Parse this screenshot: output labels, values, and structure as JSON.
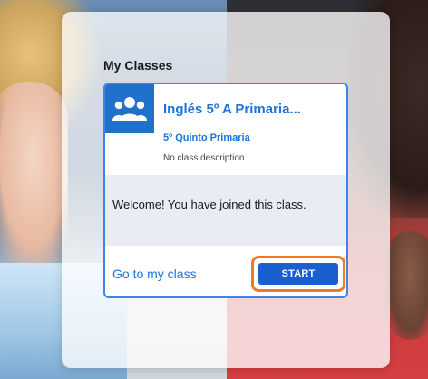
{
  "page": {
    "section_title": "My Classes"
  },
  "class_card": {
    "icon": "people-group-icon",
    "name": "Inglés 5º A Primaria...",
    "level": "5º Quinto Primaria",
    "description": "No class description",
    "welcome_message": "Welcome! You have joined this class.",
    "goto_label": "Go to my class",
    "start_label": "START",
    "colors": {
      "accent": "#1e72d8",
      "icon_bg": "#1f71c9",
      "button": "#1a5fd0",
      "highlight": "#f07a22",
      "message_bg": "#e9edf3"
    }
  }
}
